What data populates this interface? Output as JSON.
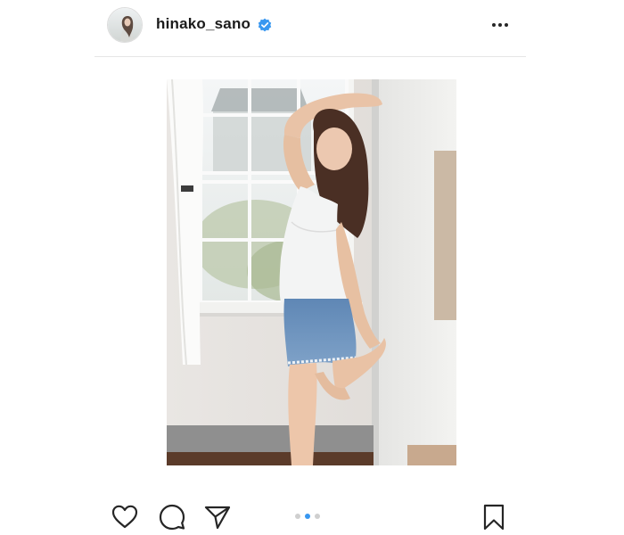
{
  "post": {
    "username": "hinako_sano",
    "verified": true,
    "carousel": {
      "total": 3,
      "current": 2
    }
  },
  "icons": {
    "more": "more-horizontal-icon",
    "like": "heart-icon",
    "comment": "comment-icon",
    "share": "paper-plane-icon",
    "save": "bookmark-icon",
    "verified": "verified-badge-icon"
  },
  "colors": {
    "verified_badge": "#3897f0",
    "active_dot": "#3897f0",
    "inactive_dot": "#cfcfcf",
    "icon_stroke": "#262626"
  }
}
